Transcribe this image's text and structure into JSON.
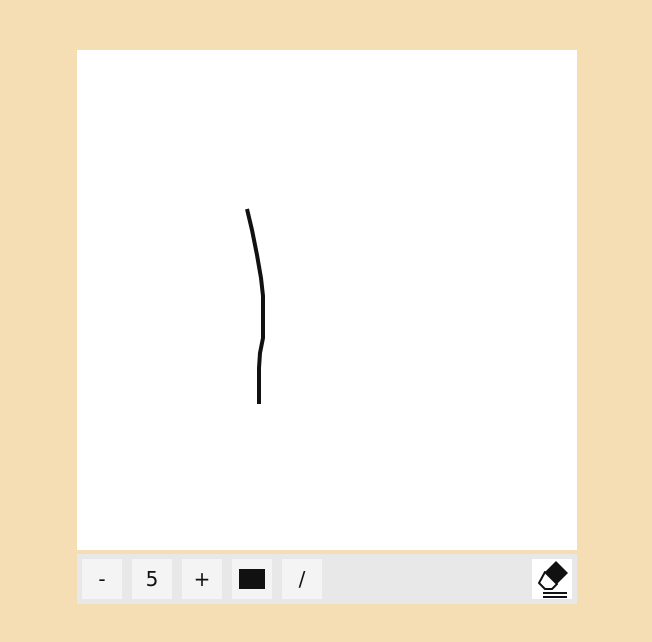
{
  "toolbar": {
    "decrease_label": "-",
    "brush_size": "5",
    "increase_label": "+",
    "color": "#111111",
    "pen_label": "/",
    "eraser_icon": "eraser-icon"
  },
  "colors": {
    "page_background": "#f5deb3",
    "canvas_background": "#ffffff",
    "toolbar_background": "#e8e8e8",
    "stroke": "#111111"
  }
}
